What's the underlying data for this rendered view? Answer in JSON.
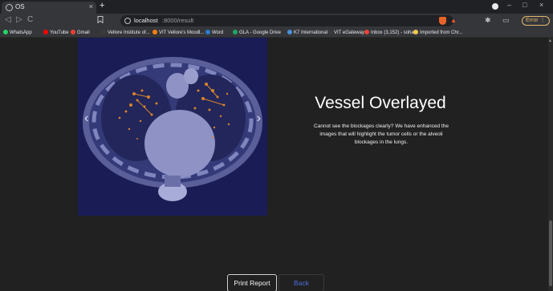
{
  "browser": {
    "tab_title": "OS",
    "tab_close": "×",
    "new_tab": "+",
    "url_host": "localhost",
    "url_path": ":8000/result",
    "error_label": "Error",
    "nav": {
      "back": "◁",
      "forward": "▷",
      "reload": "C"
    },
    "window": {
      "minimize": "–",
      "maximize": "□",
      "close": "×"
    }
  },
  "bookmarks": [
    {
      "label": "WhatsApp",
      "color": "#25d366"
    },
    {
      "label": "YouTube",
      "color": "#ff0000"
    },
    {
      "label": "Gmail",
      "color": "#ea4335"
    },
    {
      "label": "Vellore Institute of...",
      "color": "#3b3b3b"
    },
    {
      "label": "VIT Vellore's Moodl...",
      "color": "#f98012"
    },
    {
      "label": "Word",
      "color": "#2b7cd3"
    },
    {
      "label": "GLA - Google Drive",
      "color": "#1fa463"
    },
    {
      "label": "K7 International",
      "color": "#4a90d9"
    },
    {
      "label": "VIT eGateway",
      "color": "#3b3b3b"
    },
    {
      "label": "Inbox (3,152) - soha...",
      "color": "#ea4335"
    },
    {
      "label": "Imported from Chr...",
      "color": "#f2c94c"
    }
  ],
  "page": {
    "heading": "Vessel Overlayed",
    "description": "Cannot see the blockages clearly? We have enhanced the images that will highlight the tumor cells or the alveoli blockages in the lungs.",
    "carousel_prev": "‹",
    "carousel_next": "›",
    "buttons": {
      "print": "Print Report",
      "home": "Back Home"
    }
  },
  "colors": {
    "page_bg": "#212121",
    "overlay_tint": "#1a1d55",
    "vessel_highlight": "#d9822b",
    "link_blue": "#4e6ee3"
  }
}
